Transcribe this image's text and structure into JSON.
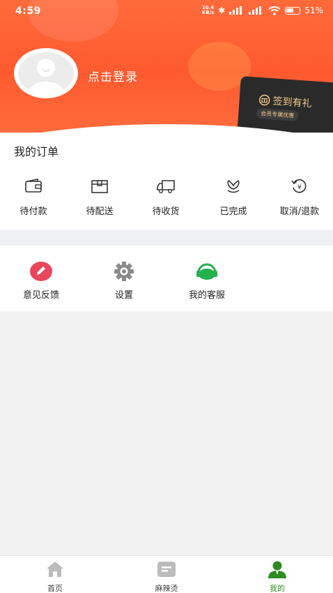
{
  "status_bar": {
    "time": "4:59",
    "net_speed_top": "10.4",
    "net_speed_bottom": "KB/s",
    "battery": "51%"
  },
  "header": {
    "login_text": "点击登录",
    "card": {
      "title": "签到有礼",
      "subtitle": "会员专属优惠"
    }
  },
  "orders": {
    "heading": "我的订单",
    "items": [
      {
        "label": "待付款",
        "icon": "wallet-icon"
      },
      {
        "label": "待配送",
        "icon": "box-icon"
      },
      {
        "label": "待收货",
        "icon": "truck-icon"
      },
      {
        "label": "已完成",
        "icon": "flower-icon"
      },
      {
        "label": "取消/退款",
        "icon": "refund-icon"
      }
    ]
  },
  "tools": [
    {
      "label": "意见反馈",
      "icon": "pencil-icon",
      "color": "#e8465b"
    },
    {
      "label": "设置",
      "icon": "gear-icon",
      "color": "#8a8a8a"
    },
    {
      "label": "我的客服",
      "icon": "headset-icon",
      "color": "#22b14c"
    }
  ],
  "bottom_nav": [
    {
      "label": "首页",
      "icon": "home-icon"
    },
    {
      "label": "麻辣烫",
      "icon": "menu-icon"
    },
    {
      "label": "我的",
      "icon": "user-icon",
      "active": true
    }
  ],
  "colors": {
    "accent": "#ff5a2f",
    "active_nav": "#2e8b1f"
  }
}
